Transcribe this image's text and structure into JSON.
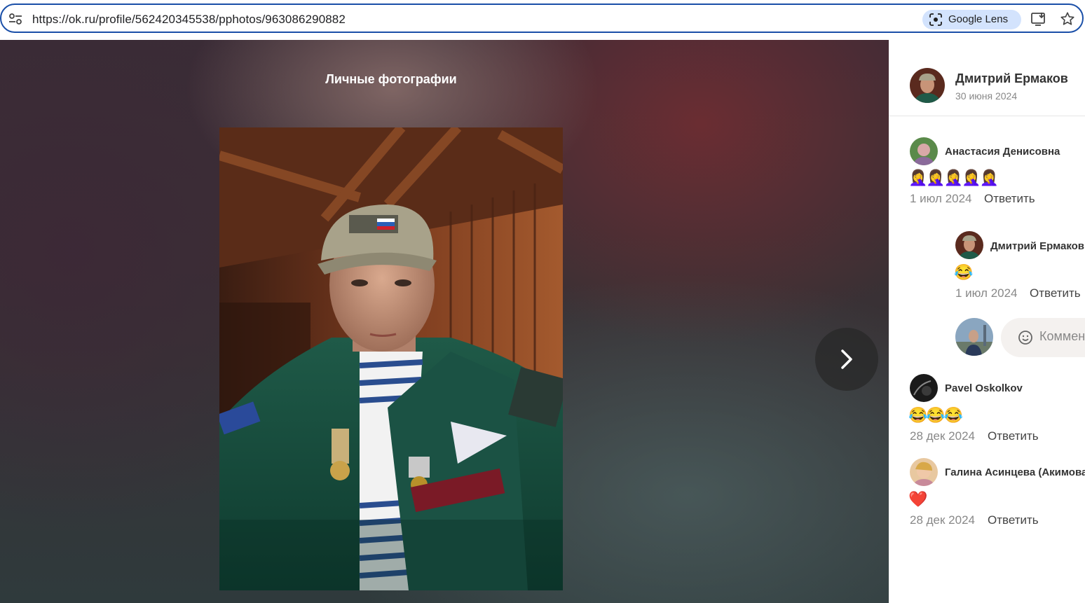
{
  "browser": {
    "url": "https://ok.ru/profile/562420345538/pphotos/963086290882",
    "lens_label": "Google Lens",
    "icons": {
      "site_info": "tune-icon",
      "lens": "google-lens-icon",
      "install": "install-app-icon",
      "bookmark": "star-icon"
    }
  },
  "viewer": {
    "album_title": "Личные фотографии",
    "next_icon": "chevron-right-icon"
  },
  "post": {
    "author_name": "Дмитрий Ермаков",
    "date": "30 июня 2024"
  },
  "comments": [
    {
      "author": "Анастасия Денисовна",
      "text": "🤦‍♀️🤦‍♀️🤦‍♀️🤦‍♀️🤦‍♀️",
      "date": "1 июл 2024",
      "reply_label": "Ответить"
    },
    {
      "author": "Дмитрий Ермаков",
      "text": "😂",
      "date": "1 июл 2024",
      "reply_label": "Ответить",
      "is_reply": true
    },
    {
      "author": "Pavel Oskolkov",
      "text": "😂😂😂",
      "date": "28 дек 2024",
      "reply_label": "Ответить"
    },
    {
      "author": "Галина Асинцева (Акимова)",
      "text": "❤️",
      "date": "28 дек 2024",
      "reply_label": "Ответить"
    }
  ],
  "comment_input": {
    "placeholder": "Комментарий"
  },
  "colors": {
    "omnibox_border": "#1a4fa8",
    "lens_bg": "#d3e3fd",
    "sidebar_bg": "#ffffff",
    "muted_text": "#888888"
  }
}
